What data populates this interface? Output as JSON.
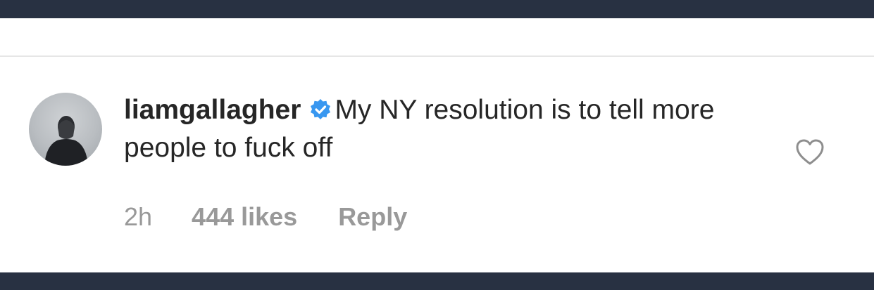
{
  "comment": {
    "username": "liamgallagher",
    "verified": true,
    "text": "My NY resolution is to tell more people to fuck off",
    "time": "2h",
    "likes": "444 likes",
    "reply_label": "Reply"
  },
  "icons": {
    "verified": "verified-badge-icon",
    "like": "heart-outline-icon"
  },
  "colors": {
    "frame_background": "#283142",
    "text": "#262626",
    "meta_text": "#999999",
    "verified_blue": "#3897f0"
  }
}
